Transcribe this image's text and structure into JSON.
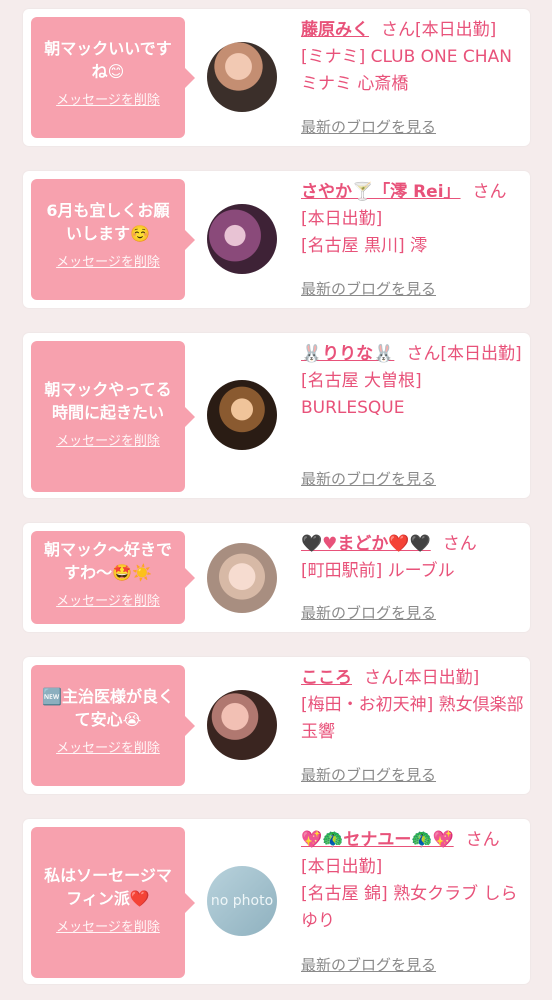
{
  "cards": [
    {
      "message": "朝マックいいですね😊",
      "delete_label": "メッセージを削除",
      "name": "藤原みく",
      "honorific": "さん",
      "status": "[本日出勤]",
      "detail": "[ミナミ] CLUB ONE CHAN ミナミ 心斎橋",
      "blog_label": "最新のブログを見る"
    },
    {
      "message": "6月も宜しくお願いします☺️",
      "delete_label": "メッセージを削除",
      "name": "さやか🍸「澪 Rei」",
      "honorific": "さん",
      "status": "[本日出勤]",
      "detail": "[名古屋 黒川] 澪",
      "blog_label": "最新のブログを見る"
    },
    {
      "message": "朝マックやってる時間に起きたい",
      "delete_label": "メッセージを削除",
      "name": "🐰りりな🐰",
      "honorific": "さん",
      "status": "[本日出勤]",
      "detail": "[名古屋 大曽根] BURLESQUE",
      "blog_label": "最新のブログを見る"
    },
    {
      "message": "朝マック〜好きですわ〜🤩☀️",
      "delete_label": "メッセージを削除",
      "name": "🖤♥まどか❤️🖤",
      "honorific": "さん",
      "status": "",
      "detail": "[町田駅前] ルーブル",
      "blog_label": "最新のブログを見る"
    },
    {
      "message": "🆕主治医様が良くて安心😭",
      "delete_label": "メッセージを削除",
      "name": "こころ",
      "honorific": "さん",
      "status": "[本日出勤]",
      "detail": "[梅田・お初天神] 熟女倶楽部 玉響",
      "blog_label": "最新のブログを見る"
    },
    {
      "message": "私はソーセージマフィン派❤️",
      "delete_label": "メッセージを削除",
      "name": "💖🦚セナユー🦚💖",
      "honorific": "さん",
      "status": "[本日出勤]",
      "detail": "[名古屋 錦] 熟女クラブ しらゆり",
      "blog_label": "最新のブログを見る",
      "avatar_placeholder": "no photo"
    }
  ],
  "colors": {
    "bubble": "#f7a1ae",
    "accent": "#e8527a",
    "link_gray": "#8a8a8a",
    "background": "#f5ecec"
  }
}
